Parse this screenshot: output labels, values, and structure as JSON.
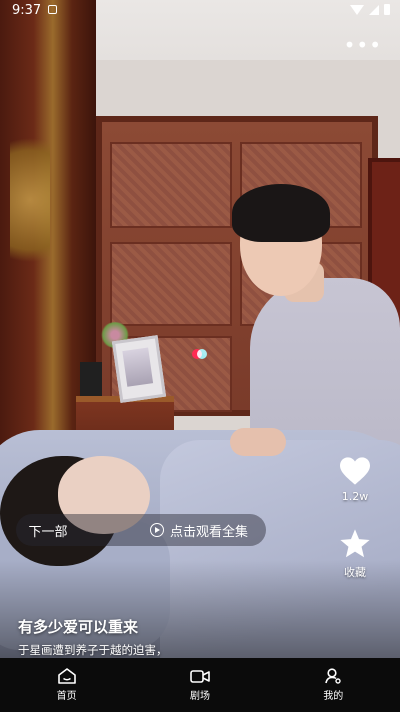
{
  "status_bar": {
    "time": "9:37"
  },
  "player": {
    "episode_bar": {
      "next_label": "下一部",
      "watch_all_label": "点击观看全集"
    },
    "actions": {
      "like_count": "1.2w",
      "collect_label": "收藏"
    },
    "drama": {
      "title": "有多少爱可以重来",
      "description": "于星画遭到养子于越的迫害，"
    },
    "more_icon": "more-dots-icon"
  },
  "bottom_nav": {
    "items": [
      {
        "label": "首页",
        "icon": "home-icon"
      },
      {
        "label": "剧场",
        "icon": "video-icon"
      },
      {
        "label": "我的",
        "icon": "profile-icon"
      }
    ]
  },
  "colors": {
    "nav_bg": "#0b0b0b",
    "overlay_text": "#ffffff"
  }
}
